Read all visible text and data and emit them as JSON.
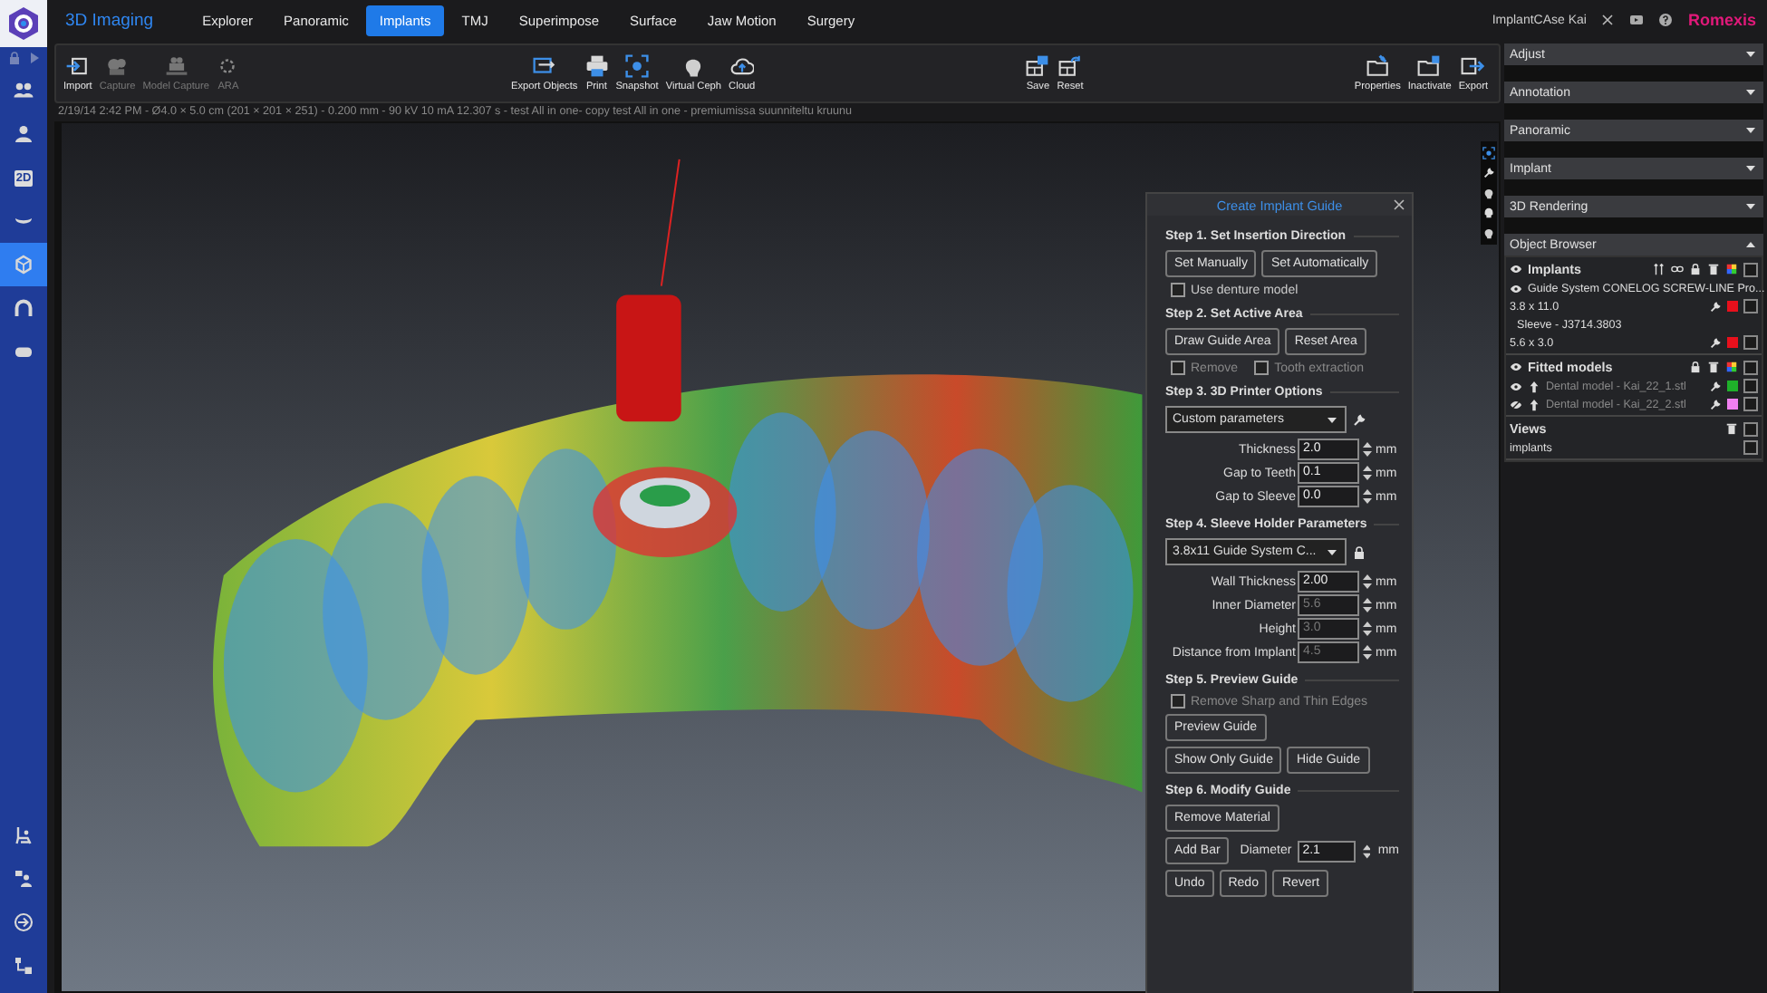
{
  "sidebar": {
    "top_items": [
      {
        "selected": false
      },
      {
        "selected": false
      },
      {
        "label": "2D",
        "selected": false
      },
      {
        "selected": false
      },
      {
        "selected": true
      },
      {
        "selected": false
      },
      {
        "selected": false
      }
    ],
    "bottom_items": [
      {
        "selected": false
      },
      {
        "selected": false
      },
      {
        "selected": false
      },
      {
        "selected": false
      }
    ]
  },
  "header": {
    "app_title": "3D Imaging",
    "patient": "ImplantCAse Kai",
    "brand": "Romexis"
  },
  "tabs": [
    {
      "label": "Explorer",
      "selected": false
    },
    {
      "label": "Panoramic",
      "selected": false
    },
    {
      "label": "Implants",
      "selected": true
    },
    {
      "label": "TMJ",
      "selected": false
    },
    {
      "label": "Superimpose",
      "selected": false
    },
    {
      "label": "Surface",
      "selected": false
    },
    {
      "label": "Jaw Motion",
      "selected": false
    },
    {
      "label": "Surgery",
      "selected": false
    }
  ],
  "toolbar": {
    "groups": [
      [
        {
          "label": "Import",
          "disabled": false
        },
        {
          "label": "Capture",
          "disabled": true
        },
        {
          "label": "Model Capture",
          "disabled": true
        },
        {
          "label": "ARA",
          "disabled": true
        }
      ],
      [
        {
          "label": "Export Objects",
          "disabled": false
        },
        {
          "label": "Print",
          "disabled": false
        },
        {
          "label": "Snapshot",
          "disabled": false
        },
        {
          "label": "Virtual Ceph",
          "disabled": false
        },
        {
          "label": "Cloud",
          "disabled": false
        }
      ],
      [
        {
          "label": "Save",
          "disabled": false
        },
        {
          "label": "Reset",
          "disabled": false
        }
      ],
      [
        {
          "label": "Properties",
          "disabled": false
        },
        {
          "label": "Inactivate",
          "disabled": false
        },
        {
          "label": "Export",
          "disabled": false
        }
      ]
    ]
  },
  "info_line": "2/19/14 2:42 PM - Ø4.0 × 5.0 cm (201 × 201 × 251) - 0.200 mm - 90 kV 10 mA 12.307 s - test All in one- copy test All in one - premiumissa suunniteltu kruunu",
  "guide_panel": {
    "title": "Create Implant Guide",
    "steps": [
      {
        "title": "Step 1. Set Insertion Direction",
        "rows": [
          {
            "kind": "buttons",
            "buttons": [
              "Set Manually",
              "Set Automatically"
            ]
          },
          {
            "kind": "checks",
            "items": [
              {
                "label": "Use denture model",
                "checked": false,
                "disabled": false
              }
            ]
          }
        ]
      },
      {
        "title": "Step 2. Set Active Area",
        "rows": [
          {
            "kind": "buttons",
            "buttons": [
              "Draw Guide Area",
              "Reset Area"
            ]
          },
          {
            "kind": "checks",
            "items": [
              {
                "label": "Remove",
                "checked": false,
                "disabled": true
              },
              {
                "label": "Tooth extraction",
                "checked": false,
                "disabled": true
              }
            ]
          }
        ]
      },
      {
        "title": "Step 3. 3D Printer Options",
        "rows": [
          {
            "kind": "select",
            "value": "Custom parameters",
            "locked": false
          },
          {
            "kind": "field",
            "label": "Thickness",
            "value": "2.0",
            "unit": "mm",
            "disabled": false
          },
          {
            "kind": "field",
            "label": "Gap to Teeth",
            "value": "0.1",
            "unit": "mm",
            "disabled": false
          },
          {
            "kind": "field",
            "label": "Gap to Sleeve",
            "value": "0.0",
            "unit": "mm",
            "disabled": false
          }
        ]
      },
      {
        "title": "Step 4. Sleeve Holder Parameters",
        "rows": [
          {
            "kind": "select",
            "value": "3.8x11 Guide System C...",
            "locked": true
          },
          {
            "kind": "field",
            "label": "Wall Thickness",
            "value": "2.00",
            "unit": "mm",
            "disabled": false
          },
          {
            "kind": "field",
            "label": "Inner Diameter",
            "value": "5.6",
            "unit": "mm",
            "disabled": true
          },
          {
            "kind": "field",
            "label": "Height",
            "value": "3.0",
            "unit": "mm",
            "disabled": true
          },
          {
            "kind": "field",
            "label": "Distance from Implant",
            "value": "4.5",
            "unit": "mm",
            "disabled": true
          }
        ]
      },
      {
        "title": "Step 5. Preview Guide",
        "rows": [
          {
            "kind": "checks",
            "items": [
              {
                "label": "Remove Sharp and Thin Edges",
                "checked": false,
                "disabled": true
              }
            ]
          },
          {
            "kind": "buttons",
            "buttons": [
              "Preview Guide"
            ]
          },
          {
            "kind": "buttons",
            "buttons": [
              "Show Only Guide",
              "Hide Guide"
            ]
          }
        ]
      },
      {
        "title": "Step 6. Modify Guide",
        "rows": [
          {
            "kind": "buttons",
            "buttons": [
              "Remove Material"
            ]
          },
          {
            "kind": "bar_field",
            "button": "Add Bar",
            "label": "Diameter",
            "value": "2.1",
            "unit": "mm",
            "disabled": false
          },
          {
            "kind": "buttons",
            "buttons": [
              "Undo",
              "Redo",
              "Revert"
            ]
          }
        ]
      }
    ]
  },
  "right_panel": {
    "sections": [
      {
        "title": "Adjust",
        "expanded": false
      },
      {
        "title": "Annotation",
        "expanded": false
      },
      {
        "title": "Panoramic",
        "expanded": false
      },
      {
        "title": "Implant",
        "expanded": false
      },
      {
        "title": "3D Rendering",
        "expanded": false
      },
      {
        "title": "Object Browser",
        "expanded": true
      }
    ],
    "object_browser": {
      "groups": [
        {
          "label": "Implants",
          "visible": true,
          "checked": false,
          "children": [
            {
              "label": "Guide System CONELOG SCREW-LINE Pro...",
              "visible": true
            },
            {
              "label": "3.8 x 11.0",
              "color": "#e8101c",
              "checked": false
            },
            {
              "label": "Sleeve - J3714.3803"
            },
            {
              "label": "5.6 x 3.0",
              "color": "#e8101c",
              "checked": false
            }
          ]
        },
        {
          "label": "Fitted models",
          "visible": true,
          "checked": false,
          "children": [
            {
              "label": "Dental model - Kai_22_1.stl",
              "visible": true,
              "color": "#1fb02a",
              "checked": false
            },
            {
              "label": "Dental model - Kai_22_2.stl",
              "visible": false,
              "color": "#f080f0",
              "checked": false
            }
          ]
        },
        {
          "label": "Views",
          "checked": false,
          "children": [
            {
              "label": "implants",
              "checked": false
            }
          ]
        }
      ]
    }
  }
}
